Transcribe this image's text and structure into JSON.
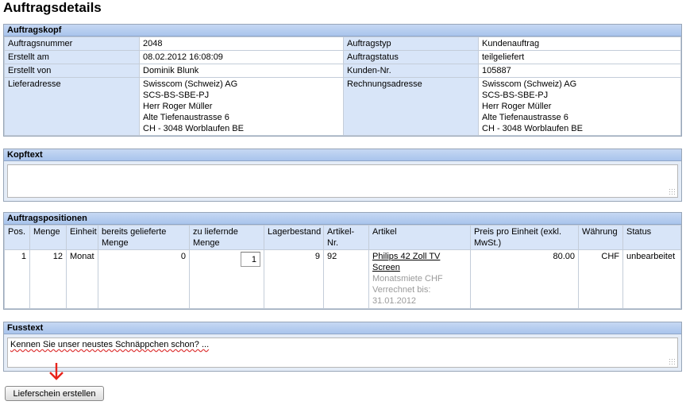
{
  "title": "Auftragsdetails",
  "head": {
    "section_title": "Auftragskopf",
    "rows": [
      {
        "l1": "Auftragsnummer",
        "v1": "2048",
        "l2": "Auftragstyp",
        "v2": "Kundenauftrag"
      },
      {
        "l1": "Erstellt am",
        "v1": "08.02.2012 16:08:09",
        "l2": "Auftragstatus",
        "v2": "teilgeliefert"
      },
      {
        "l1": "Erstellt von",
        "v1": "Dominik Blunk",
        "l2": "Kunden-Nr.",
        "v2": "105887"
      }
    ],
    "delivery_label": "Lieferadresse",
    "delivery_address": [
      "Swisscom (Schweiz) AG",
      "SCS-BS-SBE-PJ",
      "Herr Roger Müller",
      "Alte Tiefenaustrasse 6",
      "CH - 3048 Worblaufen BE"
    ],
    "billing_label": "Rechnungsadresse",
    "billing_address": [
      "Swisscom (Schweiz) AG",
      "SCS-BS-SBE-PJ",
      "Herr Roger Müller",
      "Alte Tiefenaustrasse 6",
      "CH - 3048 Worblaufen BE"
    ]
  },
  "kopftext": {
    "section_title": "Kopftext",
    "value": ""
  },
  "positions": {
    "section_title": "Auftragspositionen",
    "columns": [
      "Pos.",
      "Menge",
      "Einheit",
      "bereits gelieferte Menge",
      "zu liefernde Menge",
      "Lagerbestand",
      "Artikel-Nr.",
      "Artikel",
      "Preis pro Einheit (exkl. MwSt.)",
      "Währung",
      "Status"
    ],
    "rows": [
      {
        "pos": "1",
        "menge": "12",
        "einheit": "Monat",
        "geliefert": "0",
        "zu_liefern": "1",
        "lager": "9",
        "artikel_nr": "92",
        "artikel": "Philips 42 Zoll TV Screen",
        "artikel_detail": [
          "Monatsmiete CHF",
          "Verrechnet bis:",
          "31.01.2012"
        ],
        "preis": "80.00",
        "waehrung": "CHF",
        "status": "unbearbeitet"
      }
    ]
  },
  "fusstext": {
    "section_title": "Fusstext",
    "value": "Kennen Sie unser neustes Schnäppchen schon? ..."
  },
  "actions": {
    "create_delivery_note": "Lieferschein erstellen"
  },
  "colors": {
    "arrow": "#e8231a",
    "header_gradient_top": "#c6d8f3",
    "label_bg": "#d8e5f8"
  },
  "icons": {
    "arrow": "down-arrow-icon",
    "resize": "resize-grip-icon"
  }
}
